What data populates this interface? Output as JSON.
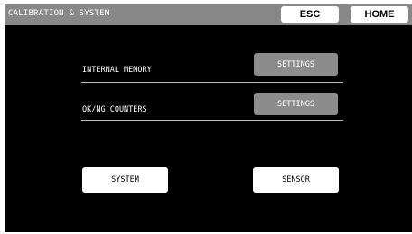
{
  "header": {
    "title": "CALIBRATION & SYSTEM",
    "esc_label": "ESC",
    "home_label": "HOME"
  },
  "rows": [
    {
      "label": "INTERNAL MEMORY",
      "button_label": "SETTINGS"
    },
    {
      "label": "OK/NG COUNTERS",
      "button_label": "SETTINGS"
    }
  ],
  "buttons": {
    "system_label": "SYSTEM",
    "sensor_label": "SENSOR"
  },
  "colors": {
    "background": "#000000",
    "titlebar": "#888888",
    "settings_button": "#8c8c8c",
    "primary_button": "#ffffff"
  }
}
